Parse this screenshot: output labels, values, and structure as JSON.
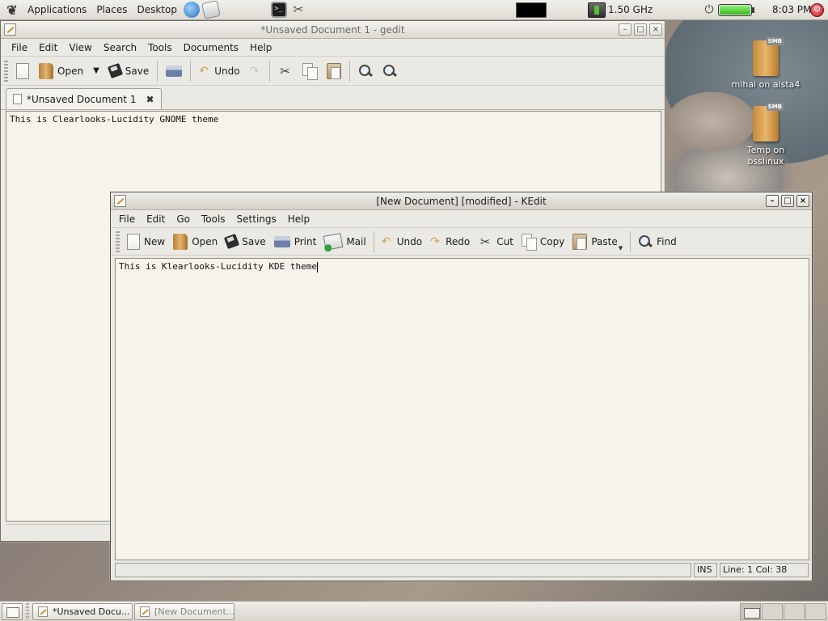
{
  "top_panel": {
    "menus": [
      "Applications",
      "Places",
      "Desktop"
    ],
    "cpu_freq": "1.50 GHz",
    "clock": "8:03 PM",
    "battery_level": 1.0
  },
  "desktop_icons": [
    {
      "label": "mihai on alsta4",
      "badge": "SMB"
    },
    {
      "label": "Temp on bsslinux",
      "badge": "SMB"
    }
  ],
  "gedit": {
    "title": "*Unsaved Document 1 - gedit",
    "menus": [
      "File",
      "Edit",
      "View",
      "Search",
      "Tools",
      "Documents",
      "Help"
    ],
    "toolbar": {
      "open": "Open",
      "save": "Save",
      "undo": "Undo"
    },
    "tab_label": "*Unsaved Document 1",
    "text": "This is Clearlooks-Lucidity GNOME theme"
  },
  "kedit": {
    "title": "[New Document] [modified] - KEdit",
    "menus": [
      "File",
      "Edit",
      "Go",
      "Tools",
      "Settings",
      "Help"
    ],
    "toolbar": {
      "new": "New",
      "open": "Open",
      "save": "Save",
      "print": "Print",
      "mail": "Mail",
      "undo": "Undo",
      "redo": "Redo",
      "cut": "Cut",
      "copy": "Copy",
      "paste": "Paste",
      "find": "Find"
    },
    "text": "This is Klearlooks-Lucidity KDE theme",
    "status": {
      "mode": "INS",
      "position": "Line: 1 Col: 38"
    }
  },
  "taskbar": [
    {
      "label": "*Unsaved Docu...",
      "active": true
    },
    {
      "label": "[New Document...",
      "active": false
    }
  ]
}
